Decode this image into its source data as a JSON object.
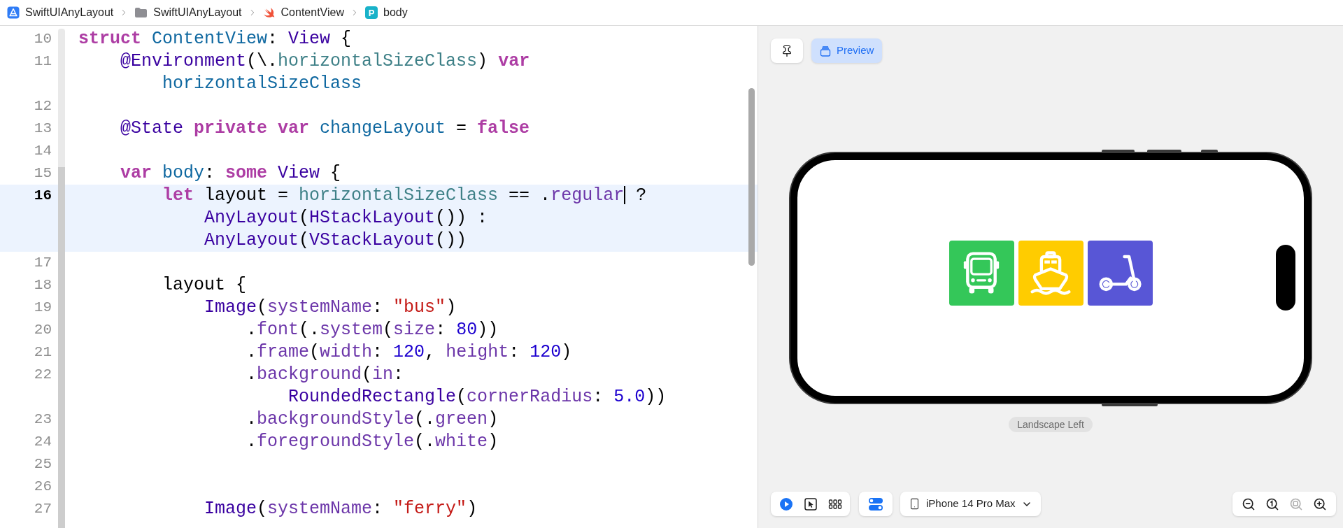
{
  "breadcrumbs": [
    {
      "kind": "app",
      "label": "SwiftUIAnyLayout"
    },
    {
      "kind": "folder",
      "label": "SwiftUIAnyLayout"
    },
    {
      "kind": "swift",
      "label": "ContentView"
    },
    {
      "kind": "property",
      "badge": "P",
      "label": "body"
    }
  ],
  "editor": {
    "lines": [
      {
        "number": "10",
        "current": false,
        "rows": [
          {
            "tokens": [
              {
                "kind": "keyword",
                "text": "struct "
              },
              {
                "kind": "decl",
                "text": "ContentView"
              },
              {
                "kind": "plain",
                "text": ": "
              },
              {
                "kind": "type",
                "text": "View"
              },
              {
                "kind": "plain",
                "text": " {"
              }
            ]
          }
        ]
      },
      {
        "number": "11",
        "current": false,
        "rows": [
          {
            "tokens": [
              {
                "kind": "type",
                "text": "    @Environment"
              },
              {
                "kind": "plain",
                "text": "(\\."
              },
              {
                "kind": "local",
                "text": "horizontalSizeClass"
              },
              {
                "kind": "plain",
                "text": ") "
              },
              {
                "kind": "keyword",
                "text": "var"
              }
            ]
          },
          {
            "tokens": [
              {
                "kind": "decl",
                "text": "        horizontalSizeClass"
              }
            ]
          }
        ]
      },
      {
        "number": "12",
        "current": false
      },
      {
        "number": "13",
        "current": false,
        "rows": [
          {
            "tokens": [
              {
                "kind": "type",
                "text": "    @State "
              },
              {
                "kind": "keyword",
                "text": "private var "
              },
              {
                "kind": "decl",
                "text": "changeLayout"
              },
              {
                "kind": "plain",
                "text": " = "
              },
              {
                "kind": "keyword",
                "text": "false"
              }
            ]
          }
        ]
      },
      {
        "number": "14",
        "current": false
      },
      {
        "number": "15",
        "current": false,
        "rows": [
          {
            "tokens": [
              {
                "kind": "keyword",
                "text": "    var "
              },
              {
                "kind": "decl",
                "text": "body"
              },
              {
                "kind": "plain",
                "text": ": "
              },
              {
                "kind": "keyword",
                "text": "some "
              },
              {
                "kind": "type",
                "text": "View"
              },
              {
                "kind": "plain",
                "text": " {"
              }
            ]
          }
        ]
      },
      {
        "number": "16",
        "current": true,
        "rows": [
          {
            "tokens": [
              {
                "kind": "keyword",
                "text": "        let"
              },
              {
                "kind": "plain",
                "text": " layout = "
              },
              {
                "kind": "local",
                "text": "horizontalSizeClass"
              },
              {
                "kind": "plain",
                "text": " == ."
              },
              {
                "kind": "member",
                "text": "regular",
                "caret": true
              },
              {
                "kind": "plain",
                "text": " ?"
              }
            ]
          },
          {
            "tokens": [
              {
                "kind": "type",
                "text": "            AnyLayout"
              },
              {
                "kind": "plain",
                "text": "("
              },
              {
                "kind": "type",
                "text": "HStackLayout"
              },
              {
                "kind": "plain",
                "text": "()) :"
              }
            ]
          },
          {
            "tokens": [
              {
                "kind": "type",
                "text": "            AnyLayout"
              },
              {
                "kind": "plain",
                "text": "("
              },
              {
                "kind": "type",
                "text": "VStackLayout"
              },
              {
                "kind": "plain",
                "text": "())"
              }
            ]
          }
        ]
      },
      {
        "number": "17",
        "current": false
      },
      {
        "number": "18",
        "current": false,
        "rows": [
          {
            "tokens": [
              {
                "kind": "plain",
                "text": "        layout {"
              }
            ]
          }
        ]
      },
      {
        "number": "19",
        "current": false,
        "rows": [
          {
            "tokens": [
              {
                "kind": "type",
                "text": "            Image"
              },
              {
                "kind": "plain",
                "text": "("
              },
              {
                "kind": "member",
                "text": "systemName"
              },
              {
                "kind": "plain",
                "text": ": "
              },
              {
                "kind": "string",
                "text": "\"bus\""
              },
              {
                "kind": "plain",
                "text": ")"
              }
            ]
          }
        ]
      },
      {
        "number": "20",
        "current": false,
        "rows": [
          {
            "tokens": [
              {
                "kind": "plain",
                "text": "                ."
              },
              {
                "kind": "member",
                "text": "font"
              },
              {
                "kind": "plain",
                "text": "(."
              },
              {
                "kind": "member",
                "text": "system"
              },
              {
                "kind": "plain",
                "text": "("
              },
              {
                "kind": "member",
                "text": "size"
              },
              {
                "kind": "plain",
                "text": ": "
              },
              {
                "kind": "number",
                "text": "80"
              },
              {
                "kind": "plain",
                "text": "))"
              }
            ]
          }
        ]
      },
      {
        "number": "21",
        "current": false,
        "rows": [
          {
            "tokens": [
              {
                "kind": "plain",
                "text": "                ."
              },
              {
                "kind": "member",
                "text": "frame"
              },
              {
                "kind": "plain",
                "text": "("
              },
              {
                "kind": "member",
                "text": "width"
              },
              {
                "kind": "plain",
                "text": ": "
              },
              {
                "kind": "number",
                "text": "120"
              },
              {
                "kind": "plain",
                "text": ", "
              },
              {
                "kind": "member",
                "text": "height"
              },
              {
                "kind": "plain",
                "text": ": "
              },
              {
                "kind": "number",
                "text": "120"
              },
              {
                "kind": "plain",
                "text": ")"
              }
            ]
          }
        ]
      },
      {
        "number": "22",
        "current": false,
        "rows": [
          {
            "tokens": [
              {
                "kind": "plain",
                "text": "                ."
              },
              {
                "kind": "member",
                "text": "background"
              },
              {
                "kind": "plain",
                "text": "("
              },
              {
                "kind": "member",
                "text": "in"
              },
              {
                "kind": "plain",
                "text": ":"
              }
            ]
          },
          {
            "tokens": [
              {
                "kind": "type",
                "text": "                    RoundedRectangle"
              },
              {
                "kind": "plain",
                "text": "("
              },
              {
                "kind": "member",
                "text": "cornerRadius"
              },
              {
                "kind": "plain",
                "text": ": "
              },
              {
                "kind": "number",
                "text": "5.0"
              },
              {
                "kind": "plain",
                "text": "))"
              }
            ]
          }
        ]
      },
      {
        "number": "23",
        "current": false,
        "rows": [
          {
            "tokens": [
              {
                "kind": "plain",
                "text": "                ."
              },
              {
                "kind": "member",
                "text": "backgroundStyle"
              },
              {
                "kind": "plain",
                "text": "(."
              },
              {
                "kind": "member",
                "text": "green"
              },
              {
                "kind": "plain",
                "text": ")"
              }
            ]
          }
        ]
      },
      {
        "number": "24",
        "current": false,
        "rows": [
          {
            "tokens": [
              {
                "kind": "plain",
                "text": "                ."
              },
              {
                "kind": "member",
                "text": "foregroundStyle"
              },
              {
                "kind": "plain",
                "text": "(."
              },
              {
                "kind": "member",
                "text": "white"
              },
              {
                "kind": "plain",
                "text": ")"
              }
            ]
          }
        ]
      },
      {
        "number": "25",
        "current": false
      },
      {
        "number": "26",
        "current": false
      },
      {
        "number": "27",
        "current": false,
        "rows": [
          {
            "tokens": [
              {
                "kind": "type",
                "text": "            Image"
              },
              {
                "kind": "plain",
                "text": "("
              },
              {
                "kind": "member",
                "text": "systemName"
              },
              {
                "kind": "plain",
                "text": ": "
              },
              {
                "kind": "string",
                "text": "\"ferry\""
              },
              {
                "kind": "plain",
                "text": ")"
              }
            ]
          }
        ]
      }
    ]
  },
  "canvas": {
    "preview_tab": {
      "label": "Preview",
      "selected": true
    },
    "tiles": [
      {
        "kind": "bus",
        "color": "#34c759"
      },
      {
        "kind": "ferry",
        "color": "#ffcc00"
      },
      {
        "kind": "scooter",
        "color": "#5856d6"
      }
    ],
    "orientation_label": "Landscape Left"
  },
  "bottom_toolbar": {
    "modes": [
      {
        "kind": "live",
        "selected": true
      },
      {
        "kind": "select",
        "selected": false
      },
      {
        "kind": "variants",
        "selected": false
      }
    ],
    "settings": {
      "selected": true
    },
    "device": {
      "label": "iPhone 14 Pro Max"
    },
    "zoom": [
      {
        "kind": "out",
        "disabled": false
      },
      {
        "kind": "actual",
        "disabled": false
      },
      {
        "kind": "fit",
        "disabled": true
      },
      {
        "kind": "in",
        "disabled": false
      }
    ]
  }
}
